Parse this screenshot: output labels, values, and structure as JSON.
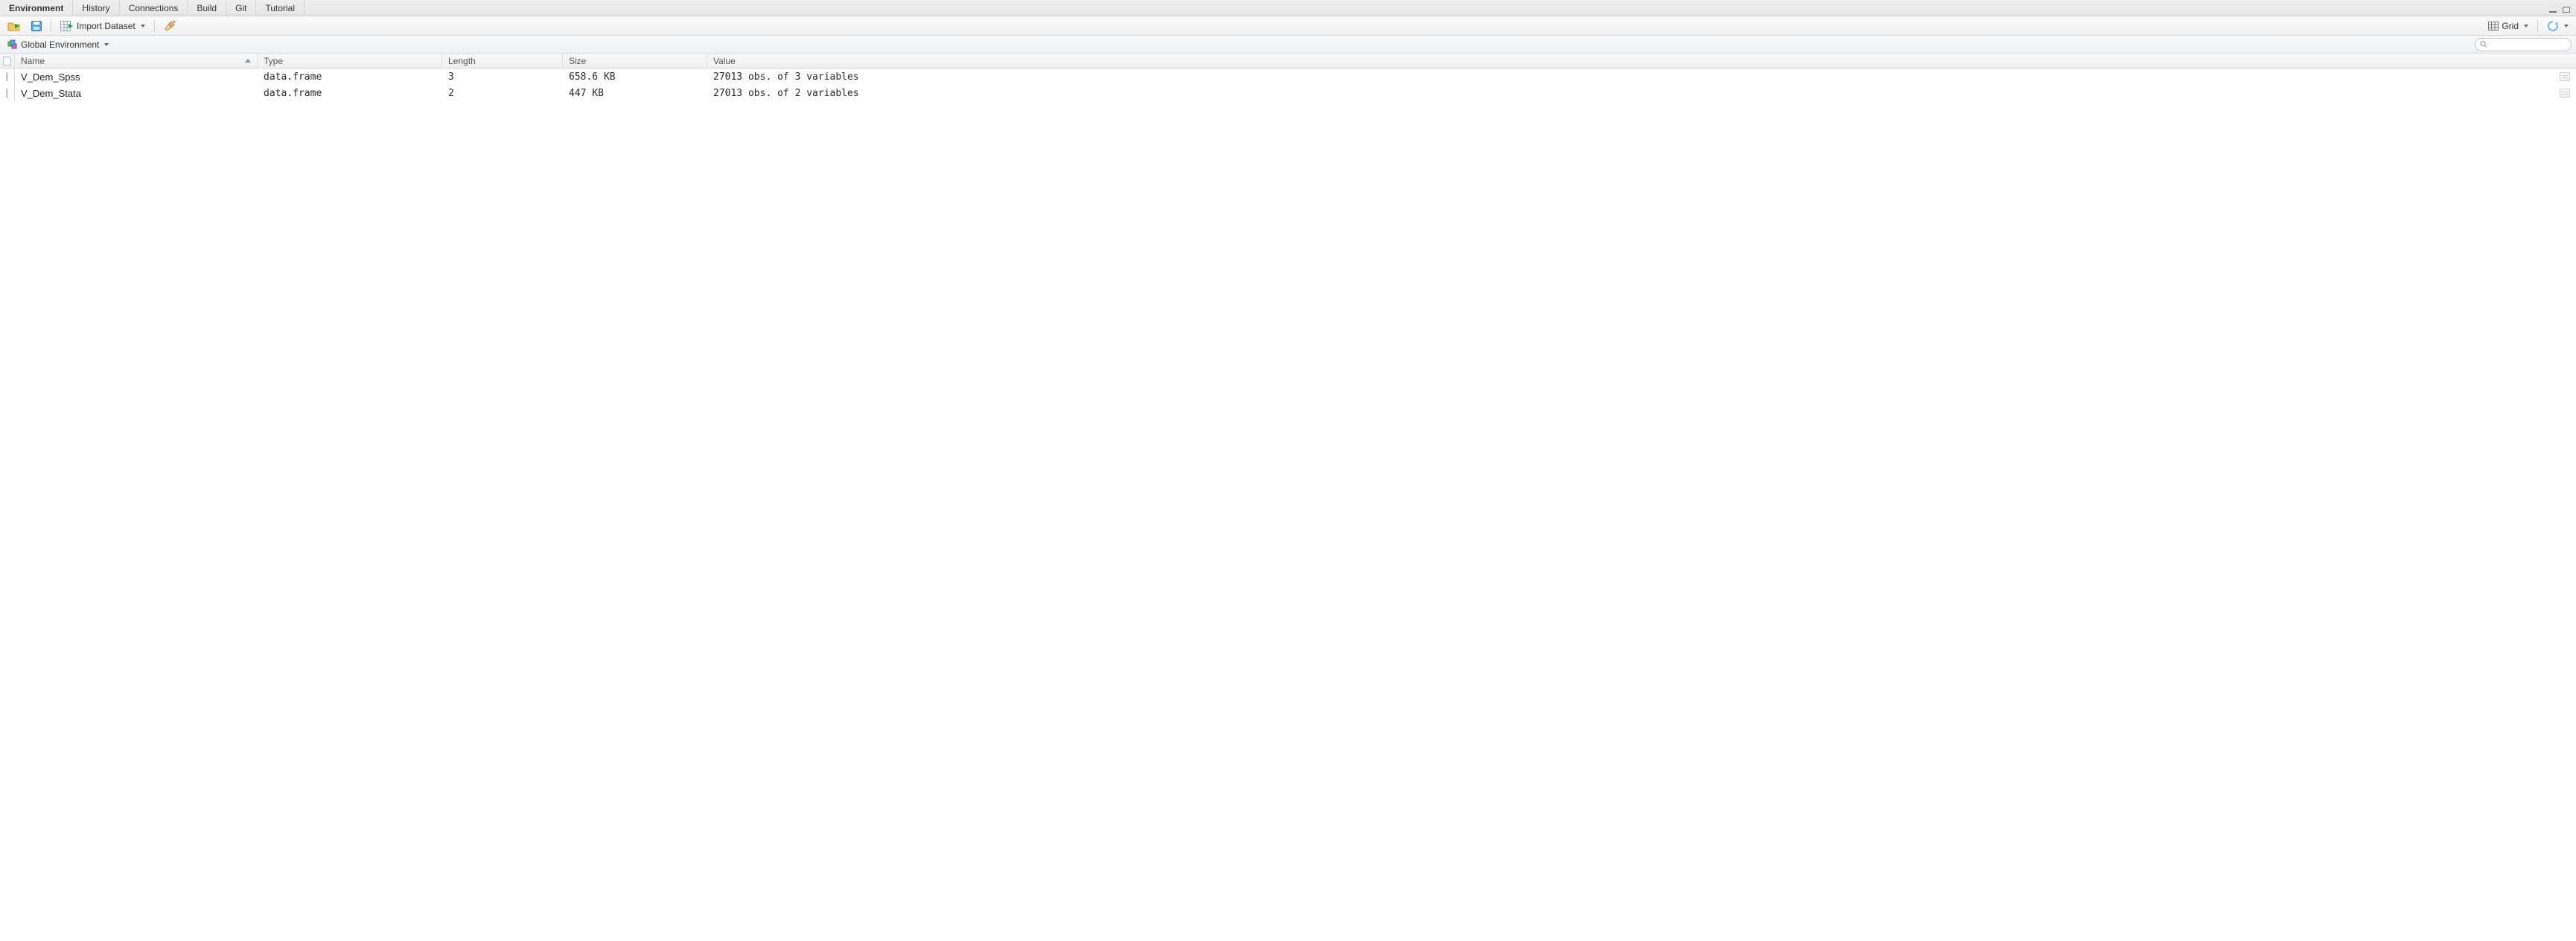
{
  "tabs": [
    {
      "label": "Environment",
      "active": true
    },
    {
      "label": "History",
      "active": false
    },
    {
      "label": "Connections",
      "active": false
    },
    {
      "label": "Build",
      "active": false
    },
    {
      "label": "Git",
      "active": false
    },
    {
      "label": "Tutorial",
      "active": false
    }
  ],
  "toolbar": {
    "import_label": "Import Dataset",
    "view_label": "Grid"
  },
  "scope": {
    "label": "Global Environment",
    "search_placeholder": ""
  },
  "columns": {
    "name": "Name",
    "type": "Type",
    "length": "Length",
    "size": "Size",
    "value": "Value"
  },
  "rows": [
    {
      "name": "V_Dem_Spss",
      "type": "data.frame",
      "length": "3",
      "size": "658.6 KB",
      "value": "27013 obs. of 3 variables"
    },
    {
      "name": "V_Dem_Stata",
      "type": "data.frame",
      "length": "2",
      "size": "447 KB",
      "value": "27013 obs. of 2 variables"
    }
  ]
}
